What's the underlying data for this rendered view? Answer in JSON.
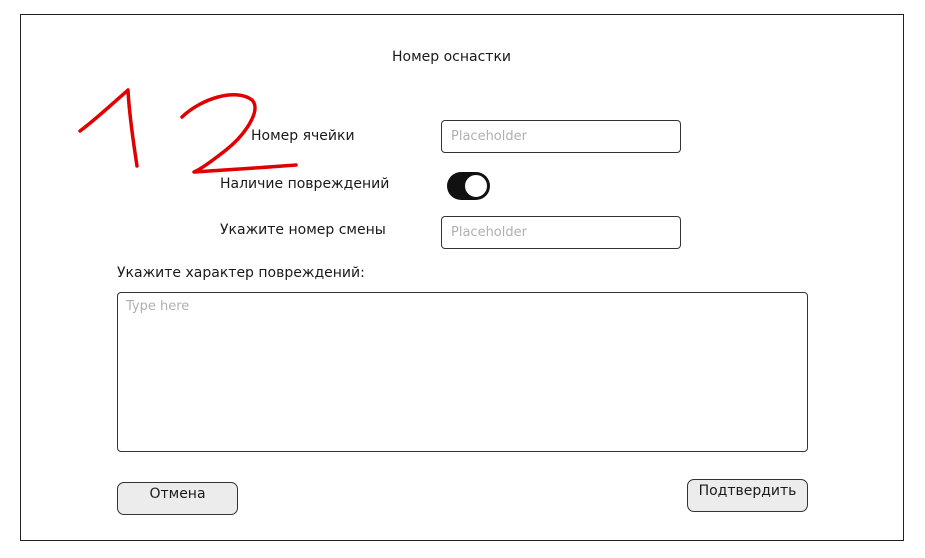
{
  "form": {
    "title": "Номер оснастки",
    "cell_label": "Номер ячейки",
    "cell_placeholder": "Placeholder",
    "damage_label": "Наличие повреждений",
    "damage_toggle_on": true,
    "shift_label": "Укажите номер смены",
    "shift_placeholder": "Placeholder",
    "description_label": "Укажите характер повреждений:",
    "description_placeholder": "Type here",
    "cancel_label": "Отмена",
    "confirm_label": "Подтвердить"
  },
  "annotation": {
    "handwritten_text": "12",
    "color": "#e00000"
  },
  "colors": {
    "border": "#222222",
    "toggle_on": "#111111",
    "button_bg": "#ececec"
  }
}
